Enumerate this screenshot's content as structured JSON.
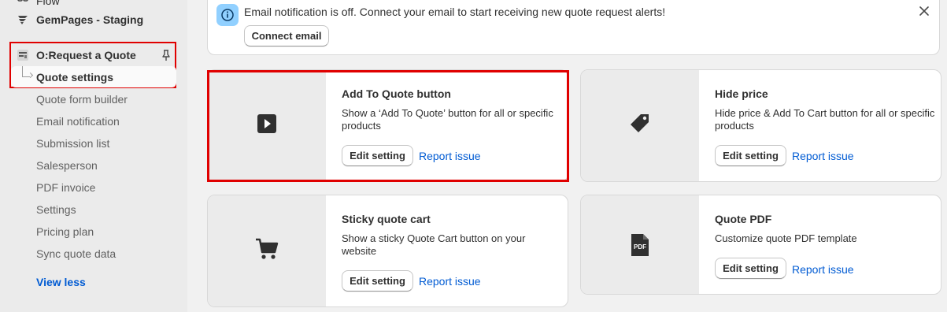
{
  "sidebar": {
    "top_items": [
      {
        "label": "Flow",
        "icon": "flow-icon"
      },
      {
        "label": "GemPages - Staging",
        "icon": "gempages-icon"
      }
    ],
    "app": {
      "label": "O:Request a Quote",
      "icon": "request-quote-app-icon",
      "pin_icon": "pin-icon"
    },
    "current": "Quote settings",
    "sub_items": [
      "Quote form builder",
      "Email notification",
      "Submission list",
      "Salesperson",
      "PDF invoice",
      "Settings",
      "Pricing plan",
      "Sync quote data"
    ],
    "view_less": "View less"
  },
  "banner": {
    "icon": "info-icon",
    "text": "Email notification is off. Connect your email to start receiving new quote request alerts!",
    "button": "Connect email",
    "close_icon": "close-icon"
  },
  "cards": [
    {
      "title": "Add To Quote button",
      "desc": "Show a ‘Add To Quote’ button for all or specific products",
      "edit": "Edit setting",
      "report": "Report issue",
      "icon": "play-icon"
    },
    {
      "title": "Hide price",
      "desc": "Hide price & Add To Cart button for all or specific products",
      "edit": "Edit setting",
      "report": "Report issue",
      "icon": "price-tag-icon"
    },
    {
      "title": "Sticky quote cart",
      "desc": "Show a sticky Quote Cart button on your website",
      "edit": "Edit setting",
      "report": "Report issue",
      "icon": "cart-icon"
    },
    {
      "title": "Quote PDF",
      "desc": "Customize quote PDF template",
      "edit": "Edit setting",
      "report": "Report issue",
      "icon": "pdf-file-icon",
      "icon_text": "PDF"
    }
  ],
  "colors": {
    "link": "#005bd3",
    "highlight": "#e00000",
    "info_badge": "#91d0ff"
  }
}
